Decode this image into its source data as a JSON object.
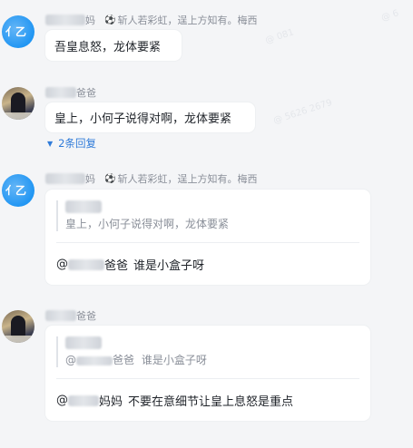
{
  "messages": [
    {
      "name_suffix": "妈",
      "status": "斩人若彩虹，逞上方知有。梅西",
      "text": "吾皇息怒，龙体要紧"
    },
    {
      "name_suffix": "爸爸",
      "text": "皇上，小何子说得对啊，龙体要紧",
      "replies_label": "2条回复"
    },
    {
      "name_suffix": "妈",
      "status": "斩人若彩虹，逞上方知有。梅西",
      "quote_text": "皇上，小何子说得对啊，龙体要紧",
      "reply_prefix": "@",
      "reply_mention_suffix": "爸爸",
      "reply_text": "谁是小盒子呀"
    },
    {
      "name_suffix": "爸爸",
      "quote_prefix": "@",
      "quote_mention_suffix": "爸爸",
      "quote_text": "谁是小盒子呀",
      "reply_prefix": "@",
      "reply_mention_suffix": "妈妈",
      "reply_text": "不要在意细节让皇上息怒是重点"
    }
  ],
  "icons": {
    "status": "soccer-ball-icon",
    "replies": "caret-down-icon"
  },
  "colors": {
    "link": "#2f7bd9",
    "background": "#f4f5f7",
    "avatar_blue": "#2196f3"
  }
}
